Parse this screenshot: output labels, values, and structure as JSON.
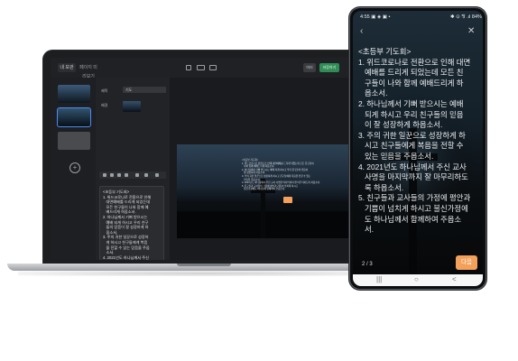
{
  "editor": {
    "tabs": [
      "내 보관",
      "페이지 미리보기"
    ],
    "buttons": {
      "preview": "미리",
      "save": "저장하기"
    },
    "props": {
      "title_label": "제목",
      "title_value": "기도",
      "bg_label": "배경"
    },
    "textbox_lines": [
      "<초등부 기도회>",
      "1. 위드코로나로 전환으로 인해",
      "   대면예배를 드리게 되었는데",
      "   모든 친구들이 나와 함께 예",
      "   배드리게 하옵소서.",
      "2. 하나님께서 기뻐 받으시는",
      "   예배 되게 하시고 우리 친구",
      "   들의 믿음이 잘 성장하게 하",
      "   옵소서.",
      "3. 주의 귀한 일꾼으로 성장하",
      "   게 하시고 친구들에게 복음",
      "   을 전할 수 있는 믿음을 주옵",
      "   소서.",
      "4. 2021년도 하나님께서 주신",
      "   교사 사명을 마지막까지 잘",
      "   마무리하도록 하옵소서."
    ],
    "slide_text": "<초등부 기도회>\n1. 위드코로나로 전환으로 인해 대면예배를 드리게 되었는데 모든 친구들이\n   나와 함께 예배드리게 하옵소서.\n2. 하나님께서 기뻐 받으시는 예배 되게 하시고 우리 친구들의 믿음이\n   잘 성장하게 하옵소서.\n3. 주의 귀한 일꾼으로 성장하게 하시고 친구들에게 복음을 전할 수 있는\n   믿음을 주옵소서.\n4. 2021년도 하나님께서 주신 교사 사명을 마지막까지 잘 마무리하도록 하옵소서.\n5. 친구들과 교사들의 가정에 평안과 기쁨이 넘치게 하시고\n   불신가정에도 하나님께 함께하여 주옵소서."
  },
  "phone": {
    "status": {
      "time": "4:55",
      "icons": "▣ ◈ ▣ •",
      "right": "✱ ⊙ ⅋ .ıl 84%"
    },
    "lines": [
      "<초등부 기도회>",
      "1. 위드코로나로 전환으로 인해 대면",
      "   예배를 드리게 되었는데 모든 친",
      "   구들이 나와 함께 예배드리게 하",
      "   옵소서.",
      "2. 하나님께서 기뻐 받으시는 예배",
      "   되게 하시고 우리 친구들의 믿음",
      "   이 잘 성장하게 하옵소서.",
      "3. 주의 귀한 일꾼으로 성장하게 하",
      "   시고 친구들에게 복음을 전할 수",
      "   있는 믿음을 주옵소서.",
      "4. 2021년도 하나님께서 주신 교사",
      "   사명을 마지막까지 잘 마무리하도",
      "   록 하옵소서.",
      "5. 친구들과 교사들의 가정에 평안과",
      "   기쁨이 넘치게 하시고 불신가정에",
      "   도 하나님께서 함께하여 주옵소",
      "   서."
    ],
    "page": "2 / 3",
    "done": "다음",
    "nav": [
      "|||",
      "○",
      "<"
    ]
  }
}
